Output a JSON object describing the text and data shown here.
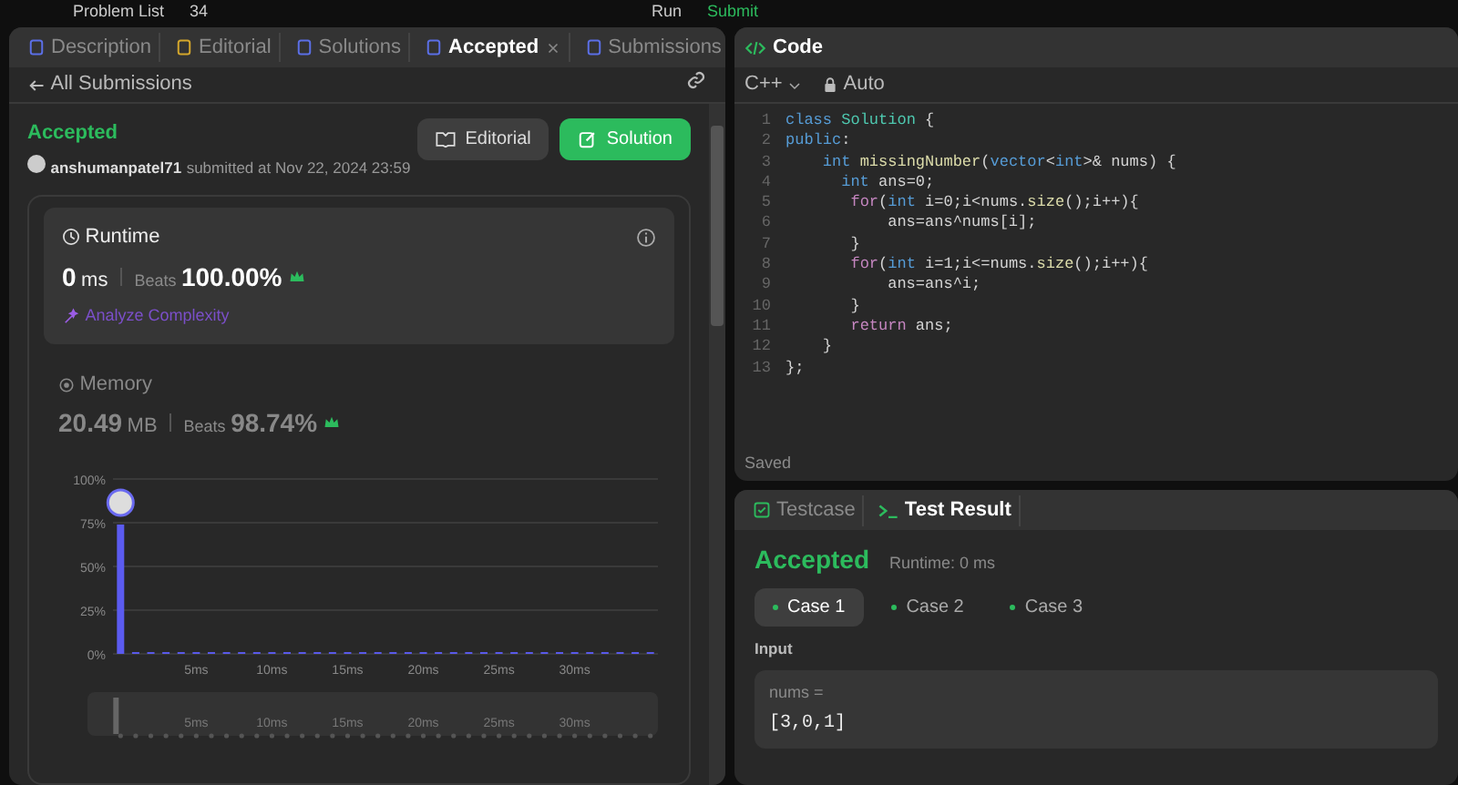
{
  "top_bar": {
    "problem_list": "Problem List",
    "problem_number": "34",
    "run": "Run",
    "submit": "Submit"
  },
  "left_tabs": [
    {
      "label": "Description",
      "selected": false,
      "closable": false
    },
    {
      "label": "Editorial",
      "selected": false,
      "closable": false
    },
    {
      "label": "Solutions",
      "selected": false,
      "closable": false
    },
    {
      "label": "Accepted",
      "selected": true,
      "closable": true
    },
    {
      "label": "Submissions",
      "selected": false,
      "closable": false
    }
  ],
  "back_link": "All Submissions",
  "submission": {
    "status": "Accepted",
    "user": "anshumanpatel71",
    "submitted": "submitted at Nov 22, 2024 23:59",
    "buttons": [
      {
        "label": "Editorial",
        "kind": "secondary"
      },
      {
        "label": "Solution",
        "kind": "success"
      }
    ]
  },
  "runtime": {
    "title": "Runtime",
    "value": "0",
    "unit": "ms",
    "beats_label": "Beats",
    "beats": "100.00%",
    "analyze": "Analyze Complexity"
  },
  "memory": {
    "title": "Memory",
    "value": "20.49",
    "unit": "MB",
    "beats_label": "Beats",
    "beats": "98.74%"
  },
  "chart_data": {
    "type": "bar",
    "x": [
      0,
      1,
      2,
      3,
      4,
      5,
      6,
      7,
      8,
      9,
      10,
      11,
      12,
      13,
      14,
      15,
      16,
      17,
      18,
      19,
      20,
      21,
      22,
      23,
      24,
      25,
      26,
      27,
      28,
      29,
      30,
      31,
      32,
      33,
      34,
      35
    ],
    "xlim": [
      -0.5,
      35.5
    ],
    "grid": true,
    "series": [
      {
        "color": "#5b5bf0",
        "values": [
          74,
          1,
          1,
          1,
          1,
          1,
          1,
          1,
          1,
          1,
          1,
          1,
          1,
          1,
          1,
          1,
          1,
          1,
          1,
          1,
          1,
          1,
          1,
          1,
          1,
          1,
          1,
          1,
          1,
          1,
          1,
          1,
          1,
          1,
          1,
          1
        ]
      }
    ],
    "ylim": [
      0,
      100
    ],
    "yticks": [
      {
        "value": 0,
        "label": "0%"
      },
      {
        "value": 25,
        "label": "25%"
      },
      {
        "value": 50,
        "label": "50%"
      },
      {
        "value": 75,
        "label": "75%"
      },
      {
        "value": 100,
        "label": "100%"
      }
    ],
    "xticks": [
      {
        "value": 5,
        "label": "5ms"
      },
      {
        "value": 10,
        "label": "10ms"
      },
      {
        "value": 15,
        "label": "15ms"
      },
      {
        "value": 20,
        "label": "20ms"
      },
      {
        "value": 25,
        "label": "25ms"
      },
      {
        "value": 30,
        "label": "30ms"
      }
    ]
  },
  "overview_labels": [
    "5ms",
    "10ms",
    "15ms",
    "20ms",
    "25ms",
    "30ms"
  ],
  "code_panel": {
    "title": "Code",
    "language": "C++",
    "mode": "Auto",
    "status": "Saved",
    "lines": [
      {
        "number": "1",
        "text": "class Solution {"
      },
      {
        "number": "2",
        "text": "public:"
      },
      {
        "number": "3",
        "text": "    int missingNumber(vector<int>& nums) {"
      },
      {
        "number": "4",
        "text": "      int ans=0;"
      },
      {
        "number": "5",
        "text": "       for(int i=0;i<nums.size();i++){"
      },
      {
        "number": "6",
        "text": "           ans=ans^nums[i];"
      },
      {
        "number": "7",
        "text": "       }"
      },
      {
        "number": "8",
        "text": "       for(int i=1;i<=nums.size();i++){"
      },
      {
        "number": "9",
        "text": "           ans=ans^i;"
      },
      {
        "number": "10",
        "text": "       }"
      },
      {
        "number": "11",
        "text": "       return ans;"
      },
      {
        "number": "12",
        "text": "    }"
      },
      {
        "number": "13",
        "text": "};"
      }
    ]
  },
  "result_panel": {
    "tabs": [
      {
        "label": "Testcase",
        "selected": false
      },
      {
        "label": "Test Result",
        "selected": true
      }
    ],
    "status": "Accepted",
    "runtime": "Runtime: 0 ms",
    "cases": [
      {
        "label": "Case 1",
        "selected": true
      },
      {
        "label": "Case 2",
        "selected": false
      },
      {
        "label": "Case 3",
        "selected": false
      }
    ],
    "input_label": "Input",
    "var_name": "nums =",
    "var_value": "[3,0,1]"
  }
}
